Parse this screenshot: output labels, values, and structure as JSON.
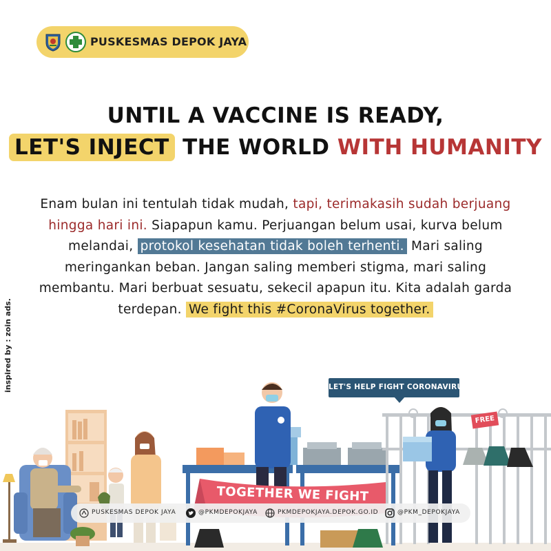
{
  "brand": {
    "name": "PUSKESMAS DEPOK JAYA"
  },
  "headline": {
    "line1": "UNTIL A VACCINE IS READY,",
    "line2_highlight": "LET'S INJECT",
    "line2_middle": " THE WORLD ",
    "line2_red": "WITH HUMANITY"
  },
  "body": {
    "p1": "Enam bulan ini tentulah tidak mudah, ",
    "p2_red": "tapi, terimakasih sudah berjuang hingga hari ini.",
    "p3": " Siapapun kamu.  Perjuangan belum usai, kurva belum melandai, ",
    "p4_blue": "protokol kesehatan tidak boleh terhenti.",
    "p5": " Mari saling meringankan beban. Jangan saling memberi stigma, mari saling membantu. Mari berbuat sesuatu, sekecil apapun itu. Kita adalah garda terdepan. ",
    "p6_yellow": "We fight this #CoronaVirus together."
  },
  "credit": "inspired by : zoin ads.",
  "illustration": {
    "speech_tag": "LET'S HELP FIGHT CORONAVIRUS!",
    "free_tag": "FREE",
    "banner": "TOGETHER WE FIGHT"
  },
  "footer": {
    "website_name": "PUSKESMAS DEPOK JAYA",
    "twitter": "@PKMDEPOKJAYA",
    "web": "PKMDEPOKJAYA.DEPOK.GO.ID",
    "instagram": "@PKM_DEPOKJAYA"
  },
  "colors": {
    "accent_yellow": "#f3d46b",
    "accent_red": "#b73636",
    "accent_blue": "#527995",
    "navy": "#2b5574"
  },
  "icons": [
    "seal-icon",
    "health-plus-icon",
    "web-icon",
    "twitter-icon",
    "globe-icon",
    "instagram-icon"
  ]
}
